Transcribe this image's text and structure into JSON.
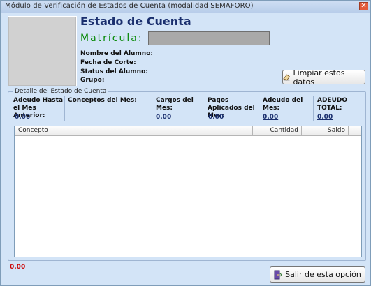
{
  "window": {
    "title": "Módulo de Verificación de Estados de Cuenta (modalidad SEMAFORO)"
  },
  "header": {
    "title": "Estado de Cuenta",
    "matricula_label": "Matrícula:",
    "matricula_value": ""
  },
  "student_fields": [
    "Nombre del Alumno:",
    "Fecha de Corte:",
    "Status del Alumno:",
    "Grupo:"
  ],
  "buttons": {
    "clear": "Limpiar estos datos",
    "exit": "Salir de esta opción"
  },
  "detail": {
    "legend": "Detalle del Estado de Cuenta",
    "columns": [
      {
        "label": "Adeudo Hasta el Mes Anterior:",
        "value": "0.00"
      },
      {
        "label": "Conceptos del Mes:",
        "value": ""
      },
      {
        "label": "Cargos del Mes:",
        "value": "0.00"
      },
      {
        "label": "Pagos Aplicados del Mes:",
        "value": "0.00"
      },
      {
        "label": "Adeudo del Mes:",
        "value": "0.00"
      },
      {
        "label": "ADEUDO TOTAL:",
        "value": "0.00"
      }
    ]
  },
  "table": {
    "headers": [
      "Concepto",
      "Cantidad",
      "Saldo"
    ],
    "rows": []
  },
  "footer": {
    "total": "0.00"
  }
}
